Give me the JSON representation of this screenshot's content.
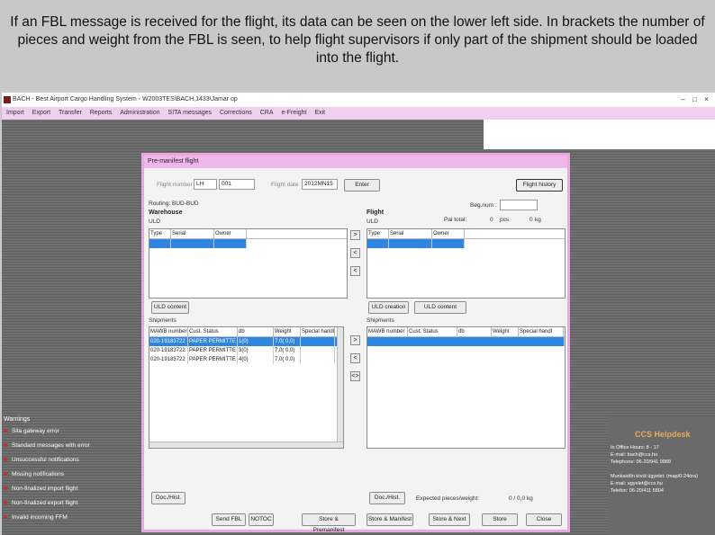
{
  "caption": "If an FBL message is received for the flight, its data can be seen on the lower left side. In brackets the number of pieces and weight from the FBL is seen, to help flight supervisors if only part of the shipment should be loaded into the flight.",
  "app": {
    "title": "BACH - Best Airport Cargo Handling System - W2003TES\\BACH,1433\\Jamar op",
    "menu": [
      "Import",
      "Export",
      "Transfer",
      "Reports",
      "Administration",
      "SITA messages",
      "Corrections",
      "CRA",
      "e-Freight",
      "Exit"
    ]
  },
  "dialog": {
    "title": "Pre-manifest flight",
    "flight_label": "Flight number",
    "flight_carrier": "LH",
    "flight_number": "001",
    "flight_date_label": "Flight date",
    "flight_date": "2012MN15",
    "enter_label": "Enter",
    "flight_history_label": "Flight history",
    "routing": "Routing: BUD-BUD",
    "warehouse": {
      "title": "Warehouse",
      "uld_label": "ULD",
      "uld_columns": [
        "Type",
        "Serial",
        "Owner"
      ],
      "uld_content_label": "ULD content",
      "shipments_label": "Shipments",
      "shipment_columns": [
        "MAWB number",
        "Cust. Status",
        "db",
        "Weight",
        "Special handl"
      ],
      "shipments": [
        [
          "020-19183722",
          "PAPER PERMITTE",
          "1(0)",
          "7,0( 0,0)",
          ""
        ],
        [
          "020-19183722",
          "PAPER PERMITTE",
          "3(0)",
          "7,0( 0,0)",
          ""
        ],
        [
          "020-19183722",
          "PAPER PERMITTE",
          "4(0)",
          "7,0( 0,0)",
          ""
        ]
      ],
      "doc_hist_label": "Doc./Hist."
    },
    "flight": {
      "title": "Flight",
      "uld_label": "ULD",
      "beg_num_label": "Beg.num :",
      "pal_total_label": "Pal total:",
      "pal_total_value": "0",
      "pcs_label": "pcs",
      "kg_value": "0",
      "kg_label": "kg",
      "uld_columns": [
        "Type",
        "Serial",
        "Owner"
      ],
      "uld_creation_label": "ULD creation",
      "uld_content_label": "ULD content",
      "shipments_label": "Shipments",
      "shipment_columns": [
        "MAWB number",
        "Cust. Status",
        "db",
        "Weight",
        "Special handl"
      ],
      "doc_hist_label": "Doc./Hist.",
      "expected_label": "Expected pieces/weight:",
      "expected_value": "0 / 0,0 kg"
    },
    "arrows": [
      ">",
      "<",
      "<"
    ],
    "ship_arrows": [
      ">",
      "<",
      "<>"
    ],
    "footer_buttons": [
      "Send FBL",
      "NOTOC",
      "Store & Premanifest",
      "Store & Manifest",
      "Store & Next",
      "Store",
      "Close"
    ]
  },
  "warnings": {
    "title": "Warnings",
    "items": [
      "Sita gateway error",
      "Standard messages with error",
      "Unsuccessful notifications",
      "Missing notifications",
      "Non-finalized import flight",
      "Non-finalized export flight",
      "Invalid incoming FFM"
    ]
  },
  "helpdesk": {
    "title": "CCS Helpdesk",
    "lines": [
      "In Office Hours: 8 - 17",
      "E-mail: bach@ccs.hu",
      "Telephone: 06-20/941 9989",
      "",
      "Munkaidőn kívül ügyelet: (map/0-24óra)",
      "E-mail: ugyelet@ccs.hu",
      "Telefon: 06-20/411 5804"
    ]
  },
  "colors": {
    "selection": "#2f86e0",
    "menubar": "#f0d0ee",
    "dialog_border": "#e9a8e0",
    "helpdesk_title": "#e9a85c"
  }
}
